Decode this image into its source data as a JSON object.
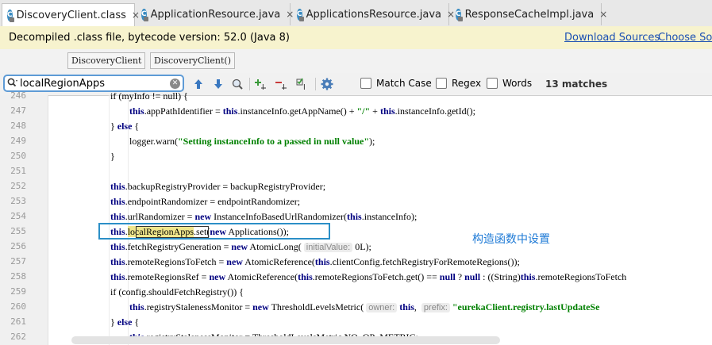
{
  "tabs": [
    {
      "label": "DiscoveryClient.class",
      "active": true
    },
    {
      "label": "ApplicationResource.java",
      "active": false
    },
    {
      "label": "ApplicationsResource.java",
      "active": false
    },
    {
      "label": "ResponseCacheImpl.java",
      "active": false
    }
  ],
  "tab_close_glyph": "×",
  "class_icon_letter": "C",
  "banner": {
    "message": "Decompiled .class file, bytecode version: 52.0 (Java 8)",
    "download_sources": "Download Sources",
    "choose_sources": "Choose Sou"
  },
  "breadcrumbs": [
    "DiscoveryClient",
    "DiscoveryClient()"
  ],
  "find": {
    "query": "localRegionApps",
    "match_case": "Match Case",
    "regex": "Regex",
    "words": "Words",
    "matches": "13 matches"
  },
  "line_numbers": [
    "246",
    "247",
    "248",
    "249",
    "250",
    "251",
    "252",
    "253",
    "254",
    "255",
    "256",
    "257",
    "258",
    "259",
    "260",
    "261",
    "262"
  ],
  "code_lines": [
    [
      {
        "t": "if (myInfo != null) {"
      }
    ],
    [
      {
        "t": "this",
        "k": "kw"
      },
      {
        "t": ".appPathIdentifier = "
      },
      {
        "t": "this",
        "k": "kw"
      },
      {
        "t": ".instanceInfo.getAppName() + "
      },
      {
        "t": "\"/\"",
        "k": "str"
      },
      {
        "t": " + "
      },
      {
        "t": "this",
        "k": "kw"
      },
      {
        "t": ".instanceInfo.getId();"
      }
    ],
    [
      {
        "t": "} "
      },
      {
        "t": "else",
        "k": "kw"
      },
      {
        "t": " {"
      }
    ],
    [
      {
        "t": "logger.warn("
      },
      {
        "t": "\"Setting instanceInfo to a passed in null value\"",
        "k": "str"
      },
      {
        "t": ");"
      }
    ],
    [
      {
        "t": "}"
      }
    ],
    [
      {
        "t": ""
      }
    ],
    [
      {
        "t": "this",
        "k": "kw"
      },
      {
        "t": ".backupRegistryProvider = backupRegistryProvider;"
      }
    ],
    [
      {
        "t": "this",
        "k": "kw"
      },
      {
        "t": ".endpointRandomizer = endpointRandomizer;"
      }
    ],
    [
      {
        "t": "this",
        "k": "kw"
      },
      {
        "t": ".urlRandomizer = "
      },
      {
        "t": "new",
        "k": "kw"
      },
      {
        "t": " InstanceInfoBasedUrlRandomizer("
      },
      {
        "t": "this",
        "k": "kw"
      },
      {
        "t": ".instanceInfo);"
      }
    ],
    [
      {
        "t": "this",
        "k": "kw"
      },
      {
        "t": "."
      },
      {
        "t": "localRegionApps",
        "k": "hl"
      },
      {
        "t": ".set("
      },
      {
        "t": "new",
        "k": "kw"
      },
      {
        "t": " Applications());"
      }
    ],
    [
      {
        "t": "this",
        "k": "kw"
      },
      {
        "t": ".fetchRegistryGeneration = "
      },
      {
        "t": "new",
        "k": "kw"
      },
      {
        "t": " AtomicLong( "
      },
      {
        "t": "initialValue:",
        "k": "hint"
      },
      {
        "t": " 0L);"
      }
    ],
    [
      {
        "t": "this",
        "k": "kw"
      },
      {
        "t": ".remoteRegionsToFetch = "
      },
      {
        "t": "new",
        "k": "kw"
      },
      {
        "t": " AtomicReference("
      },
      {
        "t": "this",
        "k": "kw"
      },
      {
        "t": ".clientConfig.fetchRegistryForRemoteRegions());"
      }
    ],
    [
      {
        "t": "this",
        "k": "kw"
      },
      {
        "t": ".remoteRegionsRef = "
      },
      {
        "t": "new",
        "k": "kw"
      },
      {
        "t": " AtomicReference("
      },
      {
        "t": "this",
        "k": "kw"
      },
      {
        "t": ".remoteRegionsToFetch.get() == "
      },
      {
        "t": "null",
        "k": "kw"
      },
      {
        "t": " ? "
      },
      {
        "t": "null",
        "k": "kw"
      },
      {
        "t": " : ((String)"
      },
      {
        "t": "this",
        "k": "kw"
      },
      {
        "t": ".remoteRegionsToFetch"
      }
    ],
    [
      {
        "t": "if (config.shouldFetchRegistry()) {"
      }
    ],
    [
      {
        "t": "this",
        "k": "kw"
      },
      {
        "t": ".registryStalenessMonitor = "
      },
      {
        "t": "new",
        "k": "kw"
      },
      {
        "t": " ThresholdLevelsMetric( "
      },
      {
        "t": "owner:",
        "k": "hint"
      },
      {
        "t": " "
      },
      {
        "t": "this",
        "k": "kw"
      },
      {
        "t": ",  "
      },
      {
        "t": "prefix:",
        "k": "hint"
      },
      {
        "t": " "
      },
      {
        "t": "\"eurekaClient.registry.lastUpdateSe",
        "k": "str"
      }
    ],
    [
      {
        "t": "} "
      },
      {
        "t": "else",
        "k": "kw"
      },
      {
        "t": " {"
      }
    ],
    [
      {
        "t": "this",
        "k": "kw"
      },
      {
        "t": ".registryStalenessMonitor = ThresholdLevelsMetric.NO_OP_METRIC;"
      }
    ]
  ],
  "annotation": "构造函数中设置"
}
